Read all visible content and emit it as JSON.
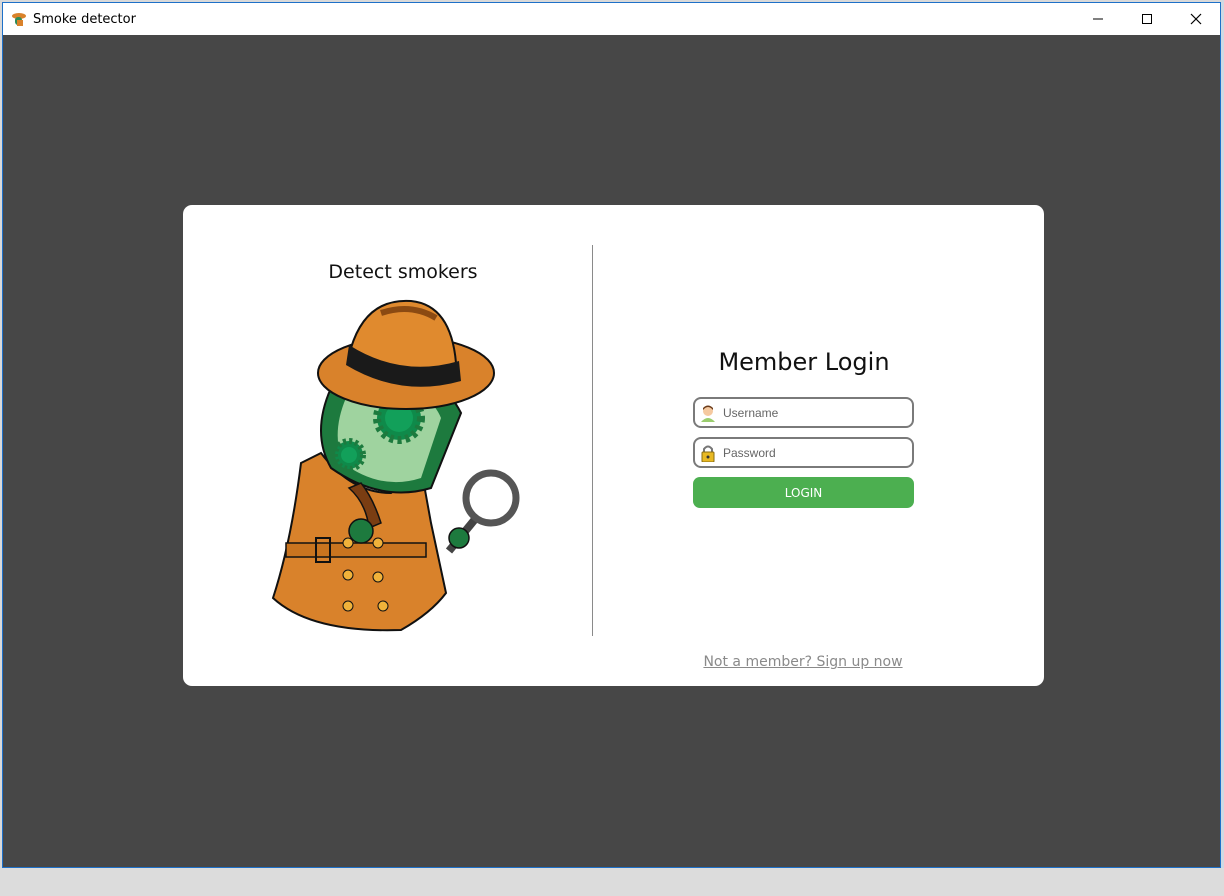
{
  "window": {
    "title": "Smoke detector",
    "icons": {
      "app": "smoke-detector-app-icon",
      "minimize": "minimize-icon",
      "maximize": "maximize-icon",
      "close": "close-icon"
    }
  },
  "left_panel": {
    "title": "Detect smokers",
    "illustration": "detective-mascot-with-pipe-and-magnifying-glass"
  },
  "login": {
    "title": "Member Login",
    "username": {
      "placeholder": "Username",
      "value": "",
      "icon": "user-icon"
    },
    "password": {
      "placeholder": "Password",
      "value": "",
      "icon": "lock-icon"
    },
    "button_label": "LOGIN",
    "signup_link": "Not a member? Sign up now"
  },
  "colors": {
    "background": "#474747",
    "card": "#ffffff",
    "accent": "#4caf50",
    "link": "#8a8a8a"
  }
}
